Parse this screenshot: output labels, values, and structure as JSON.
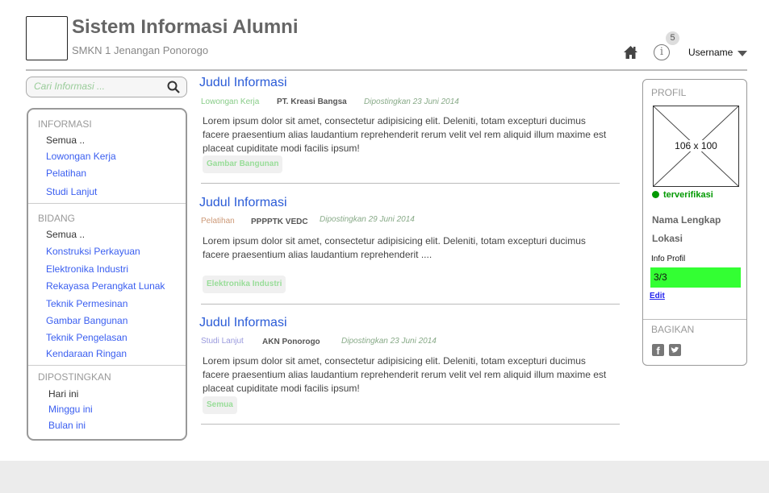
{
  "header": {
    "title": "Sistem Informasi Alumni",
    "subtitle": "SMKN 1 Jenangan Ponorogo",
    "notif_count": "5",
    "info_icon": "i",
    "username": "Username"
  },
  "search": {
    "placeholder": "Cari Informasi ..."
  },
  "sidebar": {
    "informasi": {
      "heading": "INFORMASI",
      "items": [
        "Semua ..",
        "Lowongan Kerja",
        "Pelatihan",
        "Studi Lanjut"
      ]
    },
    "bidang": {
      "heading": "BIDANG",
      "items": [
        "Semua ..",
        "Konstruksi Perkayuan",
        "Elektronika Industri",
        "Rekayasa Perangkat Lunak",
        "Teknik Permesinan",
        "Gambar Bangunan",
        "Teknik Pengelasan",
        "Kendaraan Ringan"
      ]
    },
    "dipostingkan": {
      "heading": "DIPOSTINGKAN",
      "items": [
        "Hari ini",
        "Minggu ini",
        "Bulan ini"
      ]
    }
  },
  "posts": [
    {
      "title": "Judul Informasi",
      "category": "Lowongan Kerja",
      "category_color": "#8c8",
      "org": "PT. Kreasi Bangsa",
      "date": "Dipostingkan 23 Juni 2014",
      "body": "Lorem ipsum dolor sit amet, consectetur adipisicing elit. Deleniti, totam excepturi ducimus facere praesentium alias laudantium reprehenderit rerum velit vel rem aliquid illum maxime est placeat cupiditate modi facilis ipsum!",
      "tag": "Gambar Bangunan"
    },
    {
      "title": "Judul Informasi",
      "category": "Pelatihan",
      "category_color": "#c97",
      "org": "PPPPTK VEDC",
      "date": "Dipostingkan 29 Juni 2014",
      "body": "Lorem ipsum dolor sit amet, consectetur adipisicing elit. Deleniti, totam excepturi ducimus facere praesentium alias laudantium reprehenderit ....",
      "tag": "Elektronika Industri"
    },
    {
      "title": "Judul Informasi",
      "category": "Studi Lanjut",
      "category_color": "#99d",
      "org": "AKN Ponorogo",
      "date": "Dipostingkan 23 Juni 2014",
      "body": "Lorem ipsum dolor sit amet, consectetur adipisicing elit. Deleniti, totam excepturi ducimus facere praesentium alias laudantium reprehenderit rerum velit vel rem aliquid illum maxime est placeat cupiditate modi facilis ipsum!",
      "tag": "Semua"
    }
  ],
  "profile": {
    "heading": "PROFIL",
    "image_label": "106 x 100",
    "status": "terverifikasi",
    "name": "Nama Lengkap",
    "location": "Lokasi",
    "info_label": "Info Profil",
    "progress": "3/3",
    "progress_fraction": 1,
    "edit": "Edit",
    "share_heading": "BAGIKAN"
  }
}
